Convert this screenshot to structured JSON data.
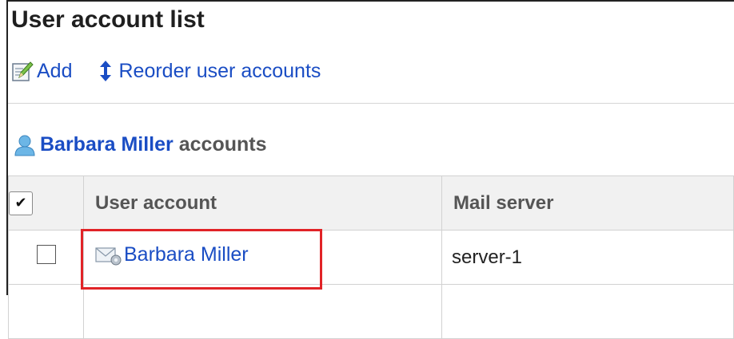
{
  "page": {
    "title": "User account list"
  },
  "toolbar": {
    "add_label": "Add",
    "reorder_label": "Reorder user accounts",
    "add_icon": "edit-note-icon",
    "reorder_icon": "vertical-arrows-icon"
  },
  "owner": {
    "name": "Barbara Miller",
    "suffix": "accounts",
    "icon": "user-icon"
  },
  "table": {
    "header_check_glyph": "✔",
    "columns": [
      "User account",
      "Mail server"
    ],
    "rows": [
      {
        "account": "Barbara Miller",
        "mail_server": "server-1",
        "icon": "mail-settings-icon"
      }
    ]
  },
  "colors": {
    "link": "#1a4dc4",
    "highlight": "#e12327",
    "header_bg": "#f1f1f1"
  }
}
